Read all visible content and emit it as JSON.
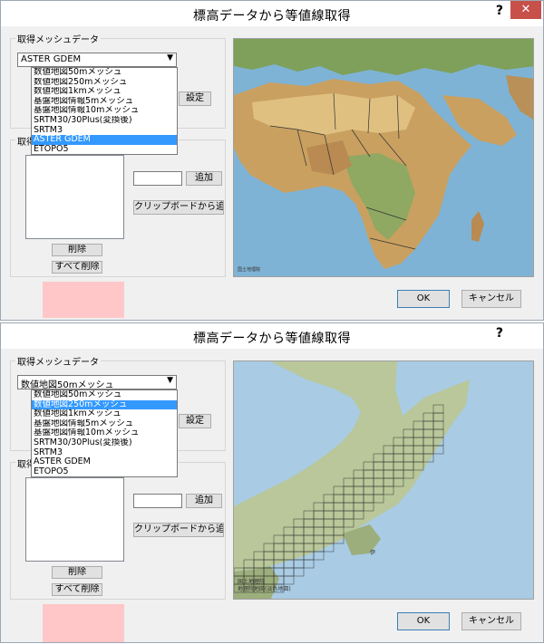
{
  "dialog": {
    "title": "標高データから等値線取得",
    "help": "?",
    "close": "✕",
    "mesh_group_label": "取得メッシュデータ",
    "area_group_label": "取得",
    "set_button": "設定",
    "add_button": "追加",
    "clipboard_add_button": "クリップボードから追加",
    "delete_button": "削除",
    "delete_all_button": "すべて削除",
    "ok_button": "OK",
    "cancel_button": "キャンセル",
    "mesh_options": [
      "数値地図50mメッシュ",
      "数値地図250mメッシュ",
      "数値地図1kmメッシュ",
      "基盤地図情報5mメッシュ",
      "基盤地図情報10mメッシュ",
      "SRTM30/30Plus(変換後)",
      "SRTM3",
      "ASTER GDEM",
      "ETOPO5"
    ]
  },
  "top": {
    "selected": "ASTER GDEM",
    "highlighted_index": 7
  },
  "bottom": {
    "selected": "数値地図50mメッシュ",
    "highlighted_index": 1
  },
  "map_top": {
    "credit": [
      "国土地理院",
      "地理院地図(淡色地図)"
    ]
  },
  "map_bottom": {
    "credit": [
      "国土地理院",
      "地理院地図(淡色地図)"
    ],
    "label": "伊"
  },
  "colors": {
    "selection": "#3399ff",
    "close": "#c7504a",
    "pink_marker": "#ffc7c7"
  }
}
